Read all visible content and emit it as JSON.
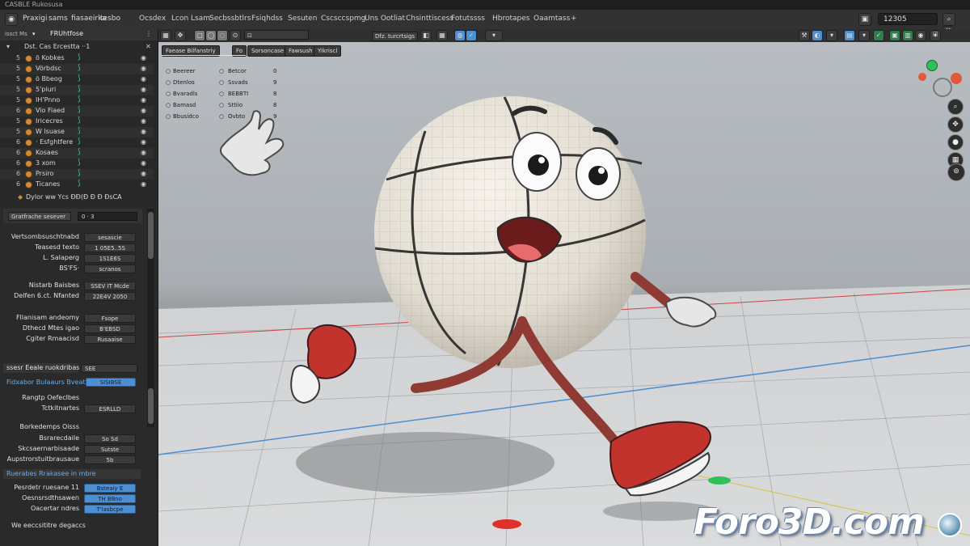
{
  "window": {
    "title": "CASBLE Rukosusa"
  },
  "menu": {
    "items": [
      "Praxigi",
      "sams",
      "fiasaeirka",
      "tesbo"
    ]
  },
  "workspaces": {
    "tabs": [
      "Ocsdex",
      "Lcon Lsam",
      "Secbssbtlrs",
      "Fsiqhdss",
      "Sesuten",
      "Cscsccspmg",
      "Uns Ootliat",
      "Chsinttiscess",
      "Fotutssss",
      "Hbrotapes",
      "Oaamtass"
    ]
  },
  "header": {
    "frame_value": "12305"
  },
  "outliner": {
    "header_left": "issct Ms",
    "header_title": "FRUhtfose",
    "root_label": "Dst. Cas Ercestta ··1",
    "rows": [
      {
        "num": "5",
        "label": "ö Kobkes"
      },
      {
        "num": "5",
        "label": "Vörbdsc"
      },
      {
        "num": "5",
        "label": "ö Bbeog"
      },
      {
        "num": "5",
        "label": "5'piuri"
      },
      {
        "num": "5",
        "label": "IH'Pnno"
      },
      {
        "num": "6",
        "label": "Vio Fiaed"
      },
      {
        "num": "5",
        "label": "Iricecres"
      },
      {
        "num": "5",
        "label": "W lsuase"
      },
      {
        "num": "6",
        "label": "· Esfghtfere"
      },
      {
        "num": "6",
        "label": "Kosaes"
      },
      {
        "num": "6",
        "label": "3 xom"
      },
      {
        "num": "6",
        "label": "Prsiro"
      },
      {
        "num": "6",
        "label": "Ticanes"
      }
    ],
    "footer": "Dylor ww Ycs ÐÐ(Ð Ð Ð ÐsCA"
  },
  "properties": {
    "search_label": "Gratfrache sesever",
    "search_value": "0 · 3",
    "group1": [
      {
        "label": "Vertsombsuschtnabd",
        "value": "sesascie"
      },
      {
        "label": "Teasesd texto",
        "value": "1 05E5..5S"
      },
      {
        "label": "L. Salaperg",
        "value": "1S1E6S"
      },
      {
        "label": "BS'FS·",
        "value": "scranos"
      }
    ],
    "group2": [
      {
        "label": "Nistarb Baisbes",
        "value": "SSEV IT Mcde"
      },
      {
        "label": "Delfen 6.ct. Nfanted",
        "value": "22E4V 2050"
      }
    ],
    "group3": [
      {
        "label": "Fllanisam andeomy",
        "value": "Fsope"
      },
      {
        "label": "Dthecd Mtes igao",
        "value": "B'EBSD"
      },
      {
        "label": "Cgiter Rmaacisd",
        "value": "Rusaaise"
      }
    ],
    "section2_title": "ssesr Eeale ruokdribas",
    "section2_value": "SEE",
    "highlight_label": "Fidxabor Bulaaurs Bveat",
    "highlight_value": "SISIBSE",
    "group4_title": "Rangtp Oefeclbes",
    "group4_row": {
      "label": "Tctkitnartes",
      "value": "ESRLLD"
    },
    "group5_title": "Borkedemps Oisss",
    "group5": [
      {
        "label": "Bsrarecdaile",
        "value": "So Sd"
      },
      {
        "label": "Skcsaernarbisaade",
        "value": "Sutste"
      },
      {
        "label": "Aupstrorstuitbrausaue",
        "value": "5b"
      }
    ],
    "section3_title": "Ruerabes Rrakasee in mbre",
    "group6": [
      {
        "label": "Pesrdetr ruesane 11",
        "value": "Bsteaiy E"
      },
      {
        "label": "Oesnsrsdthsawen",
        "value": "TH B8no"
      },
      {
        "label": "Oacertar ndres",
        "value": "T'lasbcpe"
      }
    ],
    "footer": "We eeccsititre degaccs"
  },
  "viewport_header": {
    "mode": "Dfz. turcrtsigs",
    "icons": [
      "view-icon",
      "globe-icon"
    ]
  },
  "viewport_tabs": [
    "Faease Bilfanstriy",
    "Fo",
    "Sorsoncase",
    "Fawsush",
    "Yikriscl"
  ],
  "stats": [
    {
      "left": "Beereer",
      "right": "Betcor",
      "val": "0"
    },
    {
      "left": "Dtenlos",
      "right": "Ssvads",
      "val": "9"
    },
    {
      "left": "Bvaradls",
      "right": "BEBBTI",
      "val": "8"
    },
    {
      "left": "Bamasd",
      "right": "Sttiio",
      "val": "8"
    },
    {
      "left": "Bbusidco",
      "right": "Ovbto",
      "val": "9"
    }
  ],
  "watermark": "Foro3D.com",
  "colors": {
    "accent_blue": "#4d8fd0",
    "outliner_green": "#3bd08c",
    "object_orange": "#d08a34"
  }
}
